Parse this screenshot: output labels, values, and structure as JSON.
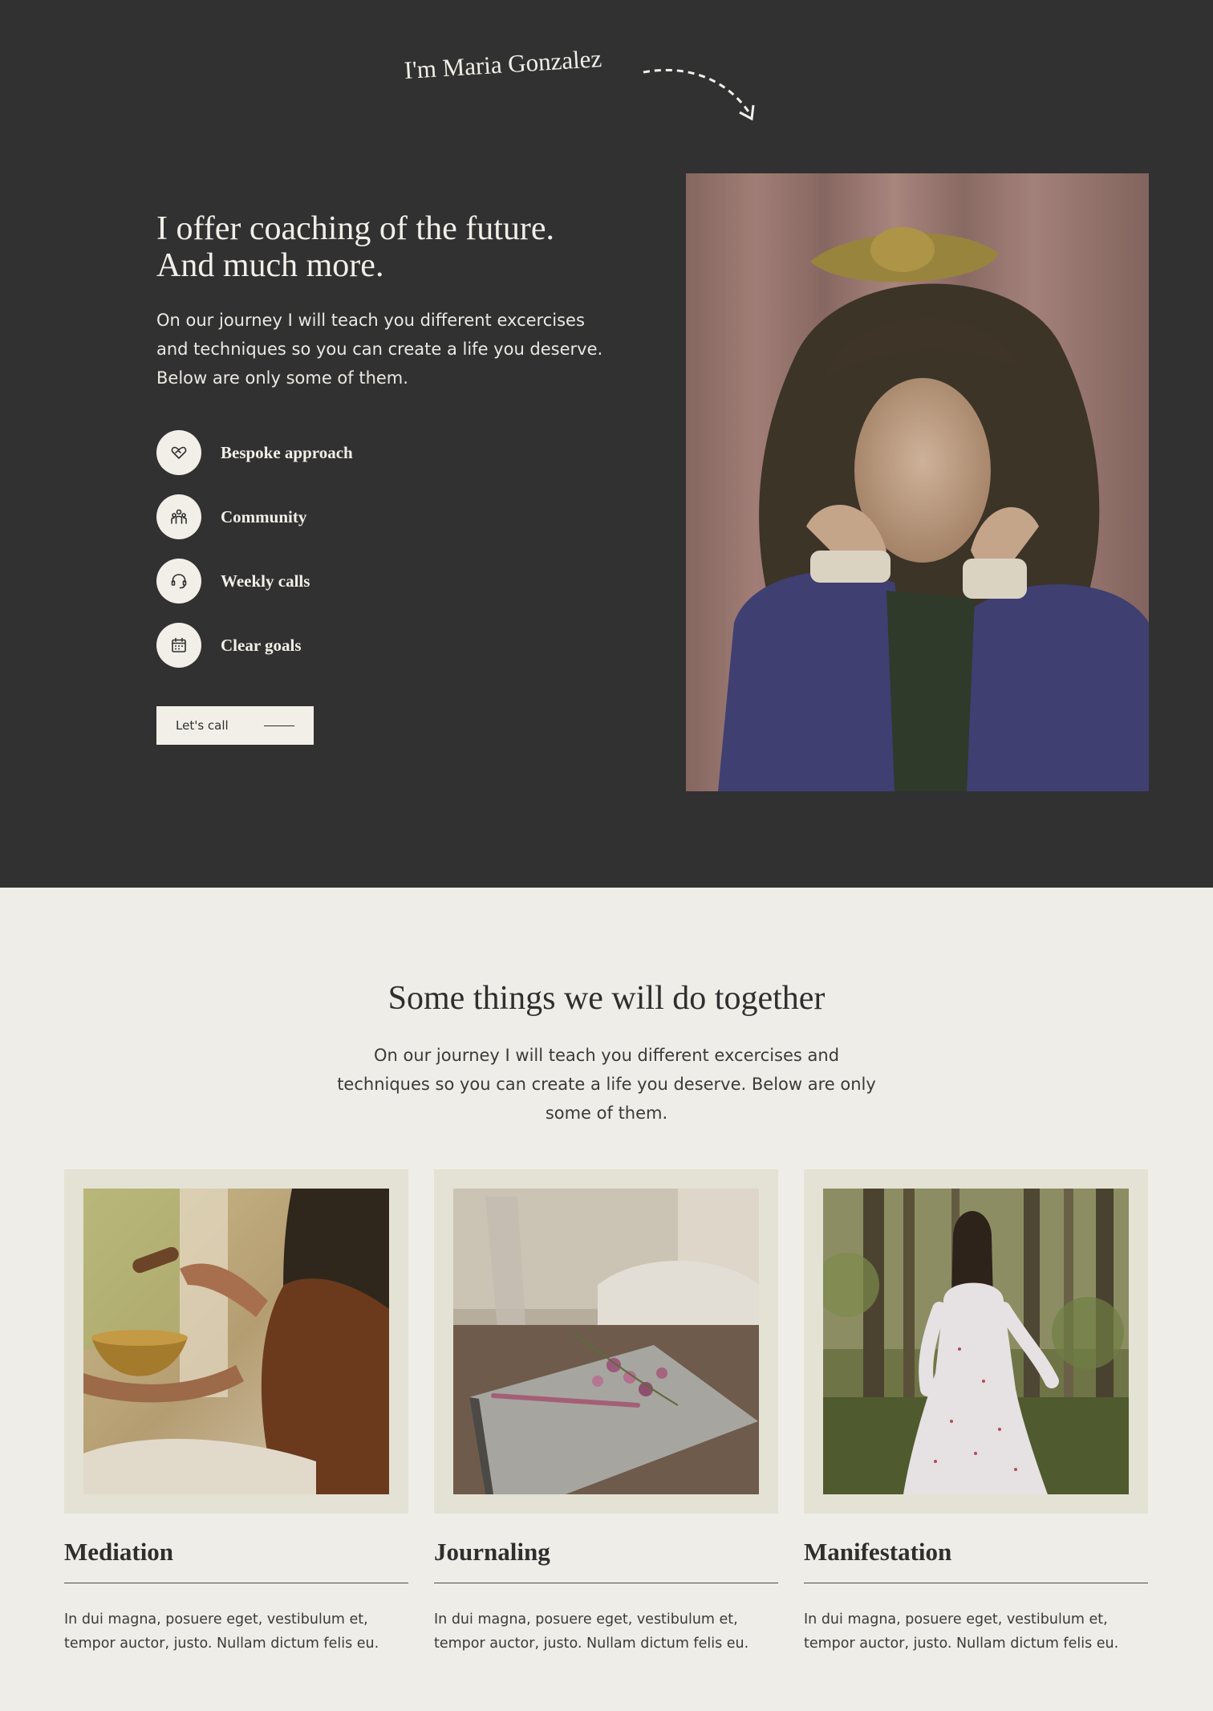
{
  "hero": {
    "tagline": "I'm Maria Gonzalez",
    "title_line1": "I offer coaching of  the future.",
    "title_line2": "And much more.",
    "description": "On our journey I will teach you different excercises and techniques so you can create a life you deserve. Below are only some of them.",
    "features": [
      {
        "label": "Bespoke approach",
        "icon": "heart-hands-icon"
      },
      {
        "label": "Community",
        "icon": "people-icon"
      },
      {
        "label": "Weekly calls",
        "icon": "headset-icon"
      },
      {
        "label": "Clear goals",
        "icon": "calendar-icon"
      }
    ],
    "cta_label": "Let's call"
  },
  "section": {
    "title": "Some things we will do together",
    "description": "On our journey I will teach you different excercises and techniques so you can create a life you deserve. Below are only some of them."
  },
  "cards": [
    {
      "title": "Mediation",
      "text": "In dui magna, posuere eget, vestibulum et, tempor auctor, justo. Nullam dictum felis eu."
    },
    {
      "title": "Journaling",
      "text": "In dui magna, posuere eget, vestibulum et, tempor auctor, justo. Nullam dictum felis eu."
    },
    {
      "title": "Manifestation",
      "text": "In dui magna, posuere eget, vestibulum et, tempor auctor, justo. Nullam dictum felis eu."
    }
  ],
  "colors": {
    "dark_bg": "#313131",
    "light_bg": "#efede7",
    "card_frame": "#e4e2d4",
    "cream": "#f1efe8"
  }
}
